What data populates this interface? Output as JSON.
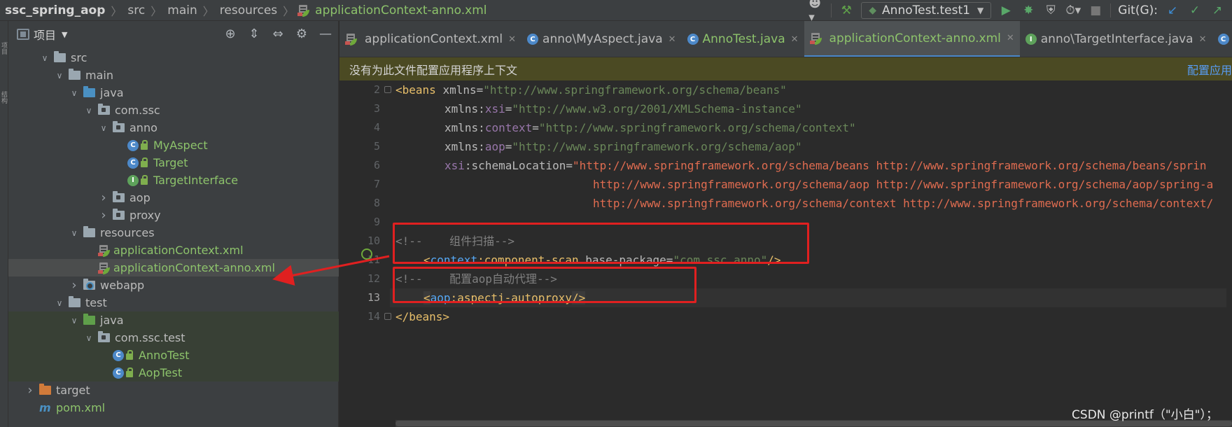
{
  "breadcrumb": {
    "project": "ssc_spring_aop",
    "path": [
      "src",
      "main",
      "resources"
    ],
    "file": "applicationContext-anno.xml"
  },
  "toolbar": {
    "run_config": "AnnoTest.test1",
    "git_label": "Git(G):"
  },
  "left_strip": {
    "labels": [
      "项目",
      "结构"
    ]
  },
  "project_panel": {
    "title": "项目"
  },
  "tree": [
    {
      "label": "src",
      "indent": 1,
      "arrow": "down",
      "icon": "folder",
      "color": "default"
    },
    {
      "label": "main",
      "indent": 2,
      "arrow": "down",
      "icon": "folder",
      "color": "default"
    },
    {
      "label": "java",
      "indent": 3,
      "arrow": "down",
      "icon": "src-folder",
      "color": "default"
    },
    {
      "label": "com.ssc",
      "indent": 4,
      "arrow": "down",
      "icon": "package",
      "color": "default"
    },
    {
      "label": "anno",
      "indent": 5,
      "arrow": "down",
      "icon": "package",
      "color": "default"
    },
    {
      "label": "MyAspect",
      "indent": 6,
      "arrow": "none",
      "icon": "class",
      "color": "green"
    },
    {
      "label": "Target",
      "indent": 6,
      "arrow": "none",
      "icon": "class",
      "color": "green"
    },
    {
      "label": "TargetInterface",
      "indent": 6,
      "arrow": "none",
      "icon": "interface",
      "color": "green"
    },
    {
      "label": "aop",
      "indent": 5,
      "arrow": "right",
      "icon": "package",
      "color": "default"
    },
    {
      "label": "proxy",
      "indent": 5,
      "arrow": "right",
      "icon": "package",
      "color": "default"
    },
    {
      "label": "resources",
      "indent": 3,
      "arrow": "down",
      "icon": "res-folder",
      "color": "default"
    },
    {
      "label": "applicationContext.xml",
      "indent": 4,
      "arrow": "none",
      "icon": "xml",
      "color": "green"
    },
    {
      "label": "applicationContext-anno.xml",
      "indent": 4,
      "arrow": "none",
      "icon": "xml",
      "color": "green",
      "selected": true
    },
    {
      "label": "webapp",
      "indent": 3,
      "arrow": "right",
      "icon": "web",
      "color": "default"
    },
    {
      "label": "test",
      "indent": 2,
      "arrow": "down",
      "icon": "folder",
      "color": "default"
    },
    {
      "label": "java",
      "indent": 3,
      "arrow": "down",
      "icon": "test-folder",
      "color": "default",
      "test": true
    },
    {
      "label": "com.ssc.test",
      "indent": 4,
      "arrow": "down",
      "icon": "package",
      "color": "default",
      "test": true
    },
    {
      "label": "AnnoTest",
      "indent": 5,
      "arrow": "none",
      "icon": "test-class",
      "color": "green",
      "test": true
    },
    {
      "label": "AopTest",
      "indent": 5,
      "arrow": "none",
      "icon": "test-class",
      "color": "green",
      "test": true
    },
    {
      "label": "target",
      "indent": 0,
      "arrow": "right",
      "icon": "target-folder",
      "color": "default"
    },
    {
      "label": "pom.xml",
      "indent": 0,
      "arrow": "none",
      "icon": "maven",
      "color": "green"
    }
  ],
  "tabs": [
    {
      "label": "applicationContext.xml",
      "icon": "xml",
      "active": false
    },
    {
      "label": "anno\\MyAspect.java",
      "icon": "class",
      "active": false
    },
    {
      "label": "AnnoTest.java",
      "icon": "test-class",
      "active": false
    },
    {
      "label": "applicationContext-anno.xml",
      "icon": "xml",
      "active": true
    },
    {
      "label": "anno\\TargetInterface.java",
      "icon": "interface",
      "active": false
    },
    {
      "label": "anno\\Target.j",
      "icon": "class",
      "active": false
    }
  ],
  "banner": {
    "message": "没有为此文件配置应用程序上下文",
    "link": "配置应用"
  },
  "code": {
    "line_numbers": [
      "2",
      "3",
      "4",
      "5",
      "6",
      "7",
      "8",
      "9",
      "10",
      "11",
      "12",
      "13",
      "14"
    ],
    "current_line": "13",
    "l2": {
      "open": "<",
      "tag": "beans",
      "attr": " xmlns=",
      "val": "\"http://www.springframework.org/schema/beans\""
    },
    "l3": {
      "ns": "xmlns",
      "colon": ":",
      "name": "xsi",
      "eq": "=",
      "val": "\"http://www.w3.org/2001/XMLSchema-instance\""
    },
    "l4": {
      "ns": "xmlns",
      "colon": ":",
      "name": "context",
      "eq": "=",
      "val": "\"http://www.springframework.org/schema/context\""
    },
    "l5": {
      "ns": "xmlns",
      "colon": ":",
      "name": "aop",
      "eq": "=",
      "val": "\"http://www.springframework.org/schema/aop\""
    },
    "l6": {
      "ns": "xsi",
      "colon": ":",
      "name": "schemaLocation",
      "eq": "=",
      "val": "\"http://www.springframework.org/schema/beans http://www.springframework.org/schema/beans/sprin"
    },
    "l7": {
      "val": "http://www.springframework.org/schema/aop http://www.springframework.org/schema/aop/spring-a"
    },
    "l8": {
      "val": "http://www.springframework.org/schema/context http://www.springframework.org/schema/context/"
    },
    "l10": {
      "text": "<!--    组件扫描-->"
    },
    "l11": {
      "open": "<",
      "ns": "context",
      "colon": ":",
      "tag": "component-scan",
      "attr": " base-package=",
      "val": "\"com.ssc.anno\"",
      "close": "/>"
    },
    "l12": {
      "text": "<!--    配置aop自动代理-->"
    },
    "l13": {
      "open": "<",
      "ns": "aop",
      "colon": ":",
      "tag": "aspectj-autoproxy",
      "close": "/>"
    },
    "l14": {
      "text": "</beans>"
    }
  },
  "watermark": "CSDN @printf（\"小白\"）；"
}
